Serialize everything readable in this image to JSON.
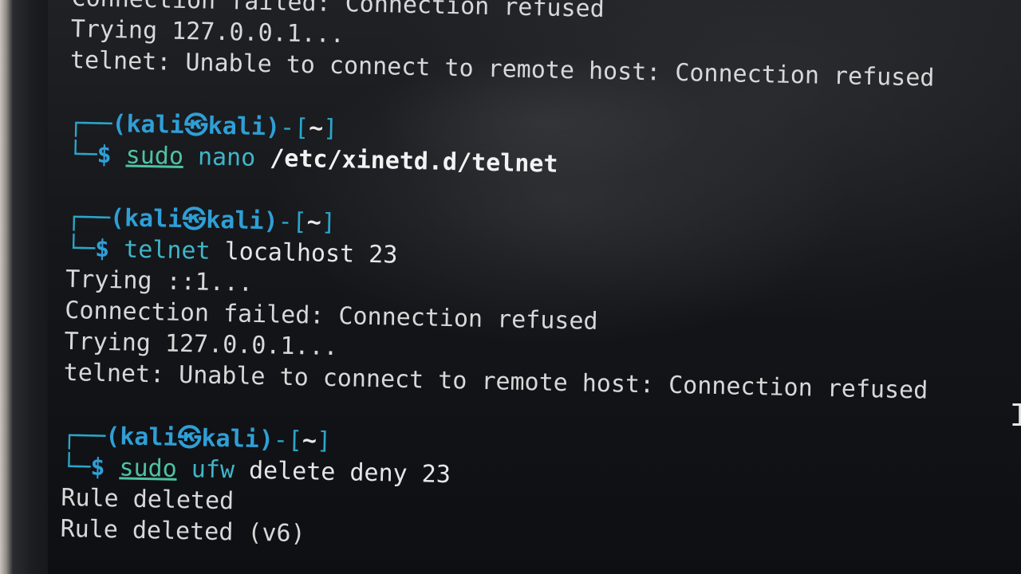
{
  "terminal": {
    "line1": "Connection failed: Connection refused",
    "line2": "Trying 127.0.0.1...",
    "line3": "telnet: Unable to connect to remote host: Connection refused",
    "prompt": {
      "corner_top": "┌──",
      "corner_bottom": "└─",
      "user_host": "(kali㉿kali)",
      "dash": "-",
      "dir_open": "[",
      "dir": "~",
      "dir_close": "]",
      "dollar": "$"
    },
    "cmd1": {
      "sudo": "sudo",
      "program": "nano",
      "arg": "/etc/xinetd.d/telnet"
    },
    "cmd2": {
      "program": "telnet",
      "arg": "localhost 23",
      "out1": "Trying ::1...",
      "out2": "Connection failed: Connection refused",
      "out3": "Trying 127.0.0.1...",
      "out4": "telnet: Unable to connect to remote host: Connection refused"
    },
    "cmd3": {
      "sudo": "sudo",
      "program": "ufw",
      "arg": "delete deny 23",
      "out1": "Rule deleted",
      "out2": "Rule deleted (v6)"
    },
    "cursor_icon": "text-cursor-ibeam"
  },
  "colors": {
    "prompt_cyan": "#2aa6c9",
    "user_blue": "#2f9fd6",
    "sudo_green": "#4fc2a4",
    "background": "#14161a",
    "text": "#d8d8d8"
  }
}
